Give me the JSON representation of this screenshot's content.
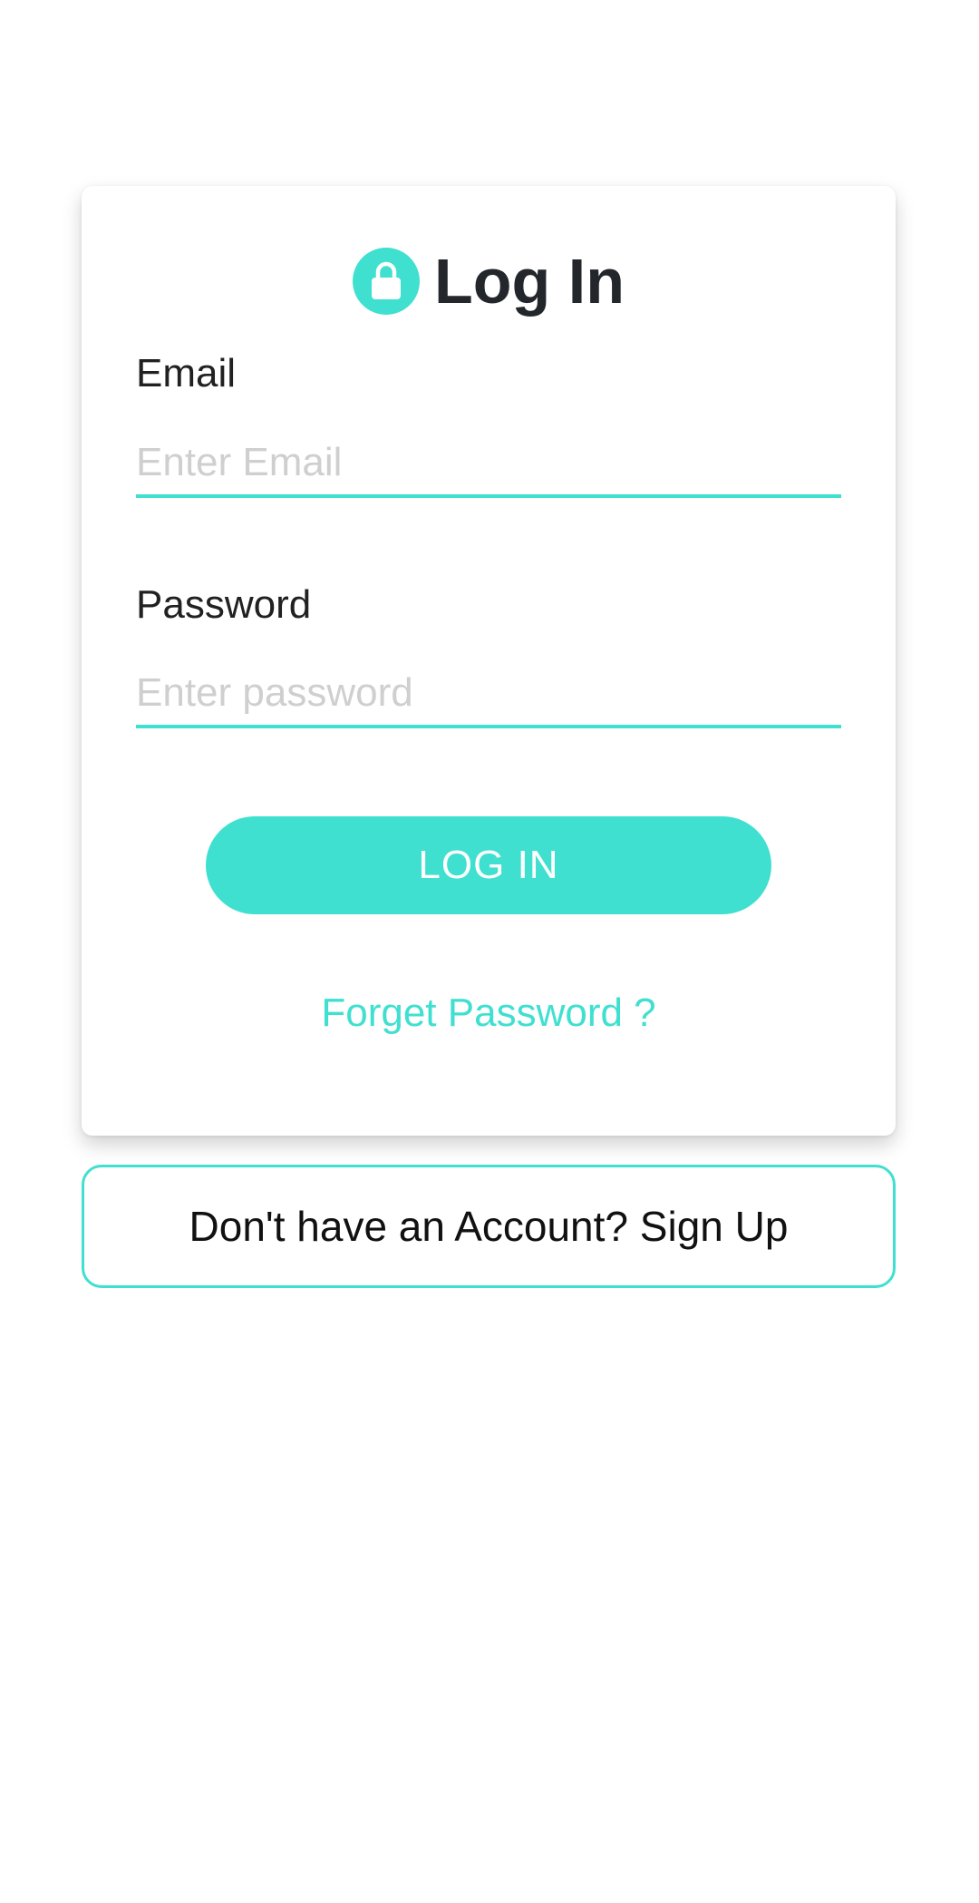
{
  "header": {
    "title": "Log In",
    "icon": "lock-icon"
  },
  "email": {
    "label": "Email",
    "placeholder": "Enter Email",
    "value": ""
  },
  "password": {
    "label": "Password",
    "placeholder": "Enter password",
    "value": ""
  },
  "login_button": {
    "label": "LOG IN"
  },
  "forget_password": {
    "label": "Forget Password ?"
  },
  "signup": {
    "label": "Don't have an Account? Sign Up"
  },
  "colors": {
    "accent": "#40e0d0",
    "text_dark": "#23262b",
    "placeholder": "#cfcfcf"
  }
}
